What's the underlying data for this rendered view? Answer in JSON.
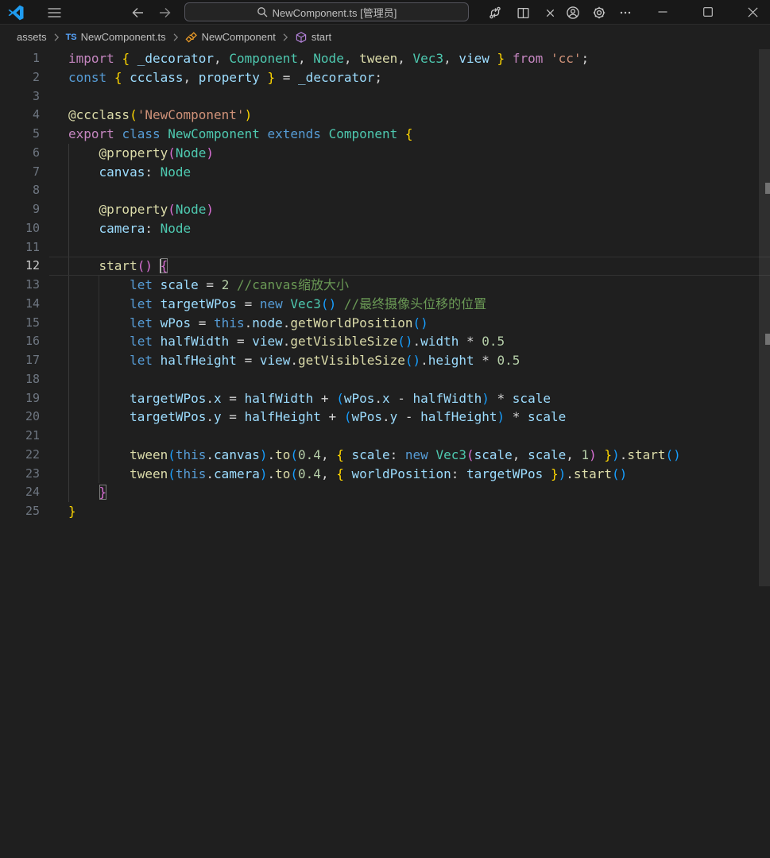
{
  "title_bar": {
    "command_center_text": "NewComponent.ts [管理员]"
  },
  "breadcrumbs": {
    "items": [
      {
        "label": "assets",
        "icon": ""
      },
      {
        "label": "NewComponent.ts",
        "icon": "ts"
      },
      {
        "label": "NewComponent",
        "icon": "class"
      },
      {
        "label": "start",
        "icon": "method"
      }
    ]
  },
  "editor": {
    "cursor_line": 12,
    "overview_mark_lines": [
      8,
      16
    ],
    "lines": [
      {
        "n": 1,
        "t": [
          [
            "import",
            "kwp"
          ],
          [
            " ",
            "pun"
          ],
          [
            "{",
            "b1"
          ],
          [
            " _decorator",
            "var"
          ],
          [
            ",",
            "pun"
          ],
          [
            " Component",
            "typ"
          ],
          [
            ",",
            "pun"
          ],
          [
            " Node",
            "typ"
          ],
          [
            ",",
            "pun"
          ],
          [
            " tween",
            "fn"
          ],
          [
            ",",
            "pun"
          ],
          [
            " Vec3",
            "typ"
          ],
          [
            ",",
            "pun"
          ],
          [
            " view",
            "var"
          ],
          [
            " ",
            "pun"
          ],
          [
            "}",
            "b1"
          ],
          [
            " ",
            "pun"
          ],
          [
            "from",
            "kwp"
          ],
          [
            " ",
            "pun"
          ],
          [
            "'cc'",
            "str"
          ],
          [
            ";",
            "pun"
          ]
        ]
      },
      {
        "n": 2,
        "t": [
          [
            "const",
            "kwb"
          ],
          [
            " ",
            "pun"
          ],
          [
            "{",
            "b1"
          ],
          [
            " ccclass",
            "var"
          ],
          [
            ",",
            "pun"
          ],
          [
            " property",
            "var"
          ],
          [
            " ",
            "pun"
          ],
          [
            "}",
            "b1"
          ],
          [
            " = ",
            "pun"
          ],
          [
            "_decorator",
            "var"
          ],
          [
            ";",
            "pun"
          ]
        ]
      },
      {
        "n": 3,
        "t": []
      },
      {
        "n": 4,
        "t": [
          [
            "@ccclass",
            "fn"
          ],
          [
            "(",
            "b1"
          ],
          [
            "'NewComponent'",
            "str"
          ],
          [
            ")",
            "b1"
          ]
        ]
      },
      {
        "n": 5,
        "t": [
          [
            "export",
            "kwp"
          ],
          [
            " ",
            "pun"
          ],
          [
            "class",
            "kwb"
          ],
          [
            " ",
            "pun"
          ],
          [
            "NewComponent",
            "typ"
          ],
          [
            " ",
            "pun"
          ],
          [
            "extends",
            "kwb"
          ],
          [
            " ",
            "pun"
          ],
          [
            "Component",
            "typ"
          ],
          [
            " ",
            "pun"
          ],
          [
            "{",
            "b1"
          ]
        ]
      },
      {
        "n": 6,
        "t": [
          [
            "    ",
            "pun"
          ],
          [
            "@property",
            "fn"
          ],
          [
            "(",
            "b2"
          ],
          [
            "Node",
            "typ"
          ],
          [
            ")",
            "b2"
          ]
        ]
      },
      {
        "n": 7,
        "t": [
          [
            "    ",
            "pun"
          ],
          [
            "canvas",
            "var"
          ],
          [
            ": ",
            "pun"
          ],
          [
            "Node",
            "typ"
          ]
        ]
      },
      {
        "n": 8,
        "t": []
      },
      {
        "n": 9,
        "t": [
          [
            "    ",
            "pun"
          ],
          [
            "@property",
            "fn"
          ],
          [
            "(",
            "b2"
          ],
          [
            "Node",
            "typ"
          ],
          [
            ")",
            "b2"
          ]
        ]
      },
      {
        "n": 10,
        "t": [
          [
            "    ",
            "pun"
          ],
          [
            "camera",
            "var"
          ],
          [
            ": ",
            "pun"
          ],
          [
            "Node",
            "typ"
          ]
        ]
      },
      {
        "n": 11,
        "t": []
      },
      {
        "n": 12,
        "t": [
          [
            "    ",
            "pun"
          ],
          [
            "start",
            "fn"
          ],
          [
            "(",
            "b2"
          ],
          [
            ")",
            "b2"
          ],
          [
            " ",
            "pun"
          ],
          [
            "",
            "cursor"
          ],
          [
            "{",
            "b2 box"
          ]
        ]
      },
      {
        "n": 13,
        "t": [
          [
            "        ",
            "pun"
          ],
          [
            "let",
            "kwb"
          ],
          [
            " ",
            "pun"
          ],
          [
            "scale",
            "var"
          ],
          [
            " = ",
            "pun"
          ],
          [
            "2",
            "num"
          ],
          [
            " ",
            "pun"
          ],
          [
            "//canvas缩放大小",
            "cmt"
          ]
        ]
      },
      {
        "n": 14,
        "t": [
          [
            "        ",
            "pun"
          ],
          [
            "let",
            "kwb"
          ],
          [
            " ",
            "pun"
          ],
          [
            "targetWPos",
            "var"
          ],
          [
            " = ",
            "pun"
          ],
          [
            "new",
            "kwb"
          ],
          [
            " ",
            "pun"
          ],
          [
            "Vec3",
            "typ"
          ],
          [
            "(",
            "b3"
          ],
          [
            ")",
            "b3"
          ],
          [
            " ",
            "pun"
          ],
          [
            "//最终摄像头位移的位置",
            "cmt"
          ]
        ]
      },
      {
        "n": 15,
        "t": [
          [
            "        ",
            "pun"
          ],
          [
            "let",
            "kwb"
          ],
          [
            " ",
            "pun"
          ],
          [
            "wPos",
            "var"
          ],
          [
            " = ",
            "pun"
          ],
          [
            "this",
            "kwb"
          ],
          [
            ".",
            "pun"
          ],
          [
            "node",
            "var"
          ],
          [
            ".",
            "pun"
          ],
          [
            "getWorldPosition",
            "fn"
          ],
          [
            "(",
            "b3"
          ],
          [
            ")",
            "b3"
          ]
        ]
      },
      {
        "n": 16,
        "t": [
          [
            "        ",
            "pun"
          ],
          [
            "let",
            "kwb"
          ],
          [
            " ",
            "pun"
          ],
          [
            "halfWidth",
            "var"
          ],
          [
            " = ",
            "pun"
          ],
          [
            "view",
            "var"
          ],
          [
            ".",
            "pun"
          ],
          [
            "getVisibleSize",
            "fn"
          ],
          [
            "(",
            "b3"
          ],
          [
            ")",
            "b3"
          ],
          [
            ".",
            "pun"
          ],
          [
            "width",
            "var"
          ],
          [
            " * ",
            "pun"
          ],
          [
            "0.5",
            "num"
          ]
        ]
      },
      {
        "n": 17,
        "t": [
          [
            "        ",
            "pun"
          ],
          [
            "let",
            "kwb"
          ],
          [
            " ",
            "pun"
          ],
          [
            "halfHeight",
            "var"
          ],
          [
            " = ",
            "pun"
          ],
          [
            "view",
            "var"
          ],
          [
            ".",
            "pun"
          ],
          [
            "getVisibleSize",
            "fn"
          ],
          [
            "(",
            "b3"
          ],
          [
            ")",
            "b3"
          ],
          [
            ".",
            "pun"
          ],
          [
            "height",
            "var"
          ],
          [
            " * ",
            "pun"
          ],
          [
            "0.5",
            "num"
          ]
        ]
      },
      {
        "n": 18,
        "t": []
      },
      {
        "n": 19,
        "t": [
          [
            "        ",
            "pun"
          ],
          [
            "targetWPos",
            "var"
          ],
          [
            ".",
            "pun"
          ],
          [
            "x",
            "var"
          ],
          [
            " = ",
            "pun"
          ],
          [
            "halfWidth",
            "var"
          ],
          [
            " + ",
            "pun"
          ],
          [
            "(",
            "b3"
          ],
          [
            "wPos",
            "var"
          ],
          [
            ".",
            "pun"
          ],
          [
            "x",
            "var"
          ],
          [
            " - ",
            "pun"
          ],
          [
            "halfWidth",
            "var"
          ],
          [
            ")",
            "b3"
          ],
          [
            " * ",
            "pun"
          ],
          [
            "scale",
            "var"
          ]
        ]
      },
      {
        "n": 20,
        "t": [
          [
            "        ",
            "pun"
          ],
          [
            "targetWPos",
            "var"
          ],
          [
            ".",
            "pun"
          ],
          [
            "y",
            "var"
          ],
          [
            " = ",
            "pun"
          ],
          [
            "halfHeight",
            "var"
          ],
          [
            " + ",
            "pun"
          ],
          [
            "(",
            "b3"
          ],
          [
            "wPos",
            "var"
          ],
          [
            ".",
            "pun"
          ],
          [
            "y",
            "var"
          ],
          [
            " - ",
            "pun"
          ],
          [
            "halfHeight",
            "var"
          ],
          [
            ")",
            "b3"
          ],
          [
            " * ",
            "pun"
          ],
          [
            "scale",
            "var"
          ]
        ]
      },
      {
        "n": 21,
        "t": []
      },
      {
        "n": 22,
        "t": [
          [
            "        ",
            "pun"
          ],
          [
            "tween",
            "fn"
          ],
          [
            "(",
            "b3"
          ],
          [
            "this",
            "kwb"
          ],
          [
            ".",
            "pun"
          ],
          [
            "canvas",
            "var"
          ],
          [
            ")",
            "b3"
          ],
          [
            ".",
            "pun"
          ],
          [
            "to",
            "fn"
          ],
          [
            "(",
            "b3"
          ],
          [
            "0.4",
            "num"
          ],
          [
            ", ",
            "pun"
          ],
          [
            "{",
            "b1"
          ],
          [
            " scale",
            "var"
          ],
          [
            ": ",
            "pun"
          ],
          [
            "new",
            "kwb"
          ],
          [
            " ",
            "pun"
          ],
          [
            "Vec3",
            "typ"
          ],
          [
            "(",
            "b2"
          ],
          [
            "scale",
            "var"
          ],
          [
            ", ",
            "pun"
          ],
          [
            "scale",
            "var"
          ],
          [
            ", ",
            "pun"
          ],
          [
            "1",
            "num"
          ],
          [
            ")",
            "b2"
          ],
          [
            " ",
            "pun"
          ],
          [
            "}",
            "b1"
          ],
          [
            ")",
            "b3"
          ],
          [
            ".",
            "pun"
          ],
          [
            "start",
            "fn"
          ],
          [
            "(",
            "b3"
          ],
          [
            ")",
            "b3"
          ]
        ]
      },
      {
        "n": 23,
        "t": [
          [
            "        ",
            "pun"
          ],
          [
            "tween",
            "fn"
          ],
          [
            "(",
            "b3"
          ],
          [
            "this",
            "kwb"
          ],
          [
            ".",
            "pun"
          ],
          [
            "camera",
            "var"
          ],
          [
            ")",
            "b3"
          ],
          [
            ".",
            "pun"
          ],
          [
            "to",
            "fn"
          ],
          [
            "(",
            "b3"
          ],
          [
            "0.4",
            "num"
          ],
          [
            ", ",
            "pun"
          ],
          [
            "{",
            "b1"
          ],
          [
            " worldPosition",
            "var"
          ],
          [
            ": ",
            "pun"
          ],
          [
            "targetWPos",
            "var"
          ],
          [
            " ",
            "pun"
          ],
          [
            "}",
            "b1"
          ],
          [
            ")",
            "b3"
          ],
          [
            ".",
            "pun"
          ],
          [
            "start",
            "fn"
          ],
          [
            "(",
            "b3"
          ],
          [
            ")",
            "b3"
          ]
        ]
      },
      {
        "n": 24,
        "t": [
          [
            "    ",
            "pun"
          ],
          [
            "}",
            "b2 box"
          ]
        ]
      },
      {
        "n": 25,
        "t": [
          [
            "}",
            "b1"
          ]
        ]
      }
    ]
  },
  "colors": {
    "titlebar_bg": "#181818",
    "editor_bg": "#1F1F1F",
    "keyword_pink": "#C586C0",
    "keyword_blue": "#569CD6",
    "variable": "#9CDCFE",
    "function": "#DCDCAA",
    "type": "#4EC9B0",
    "string": "#CE9178",
    "number": "#B5CEA8",
    "comment": "#6A9955",
    "bracket_gold": "#FFD700",
    "bracket_pink": "#DA70D6",
    "bracket_blue": "#179FFF",
    "ts_icon": "#58A6FF",
    "class_icon": "#EE9D28",
    "method_icon": "#B180D7",
    "logo_blue": "#1F9CF0"
  }
}
